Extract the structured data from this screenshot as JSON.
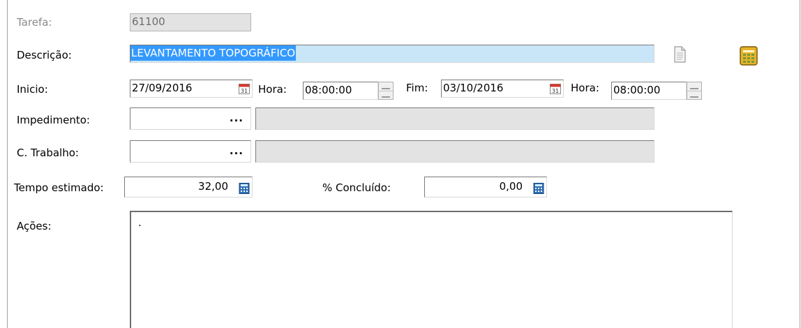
{
  "tarefa": {
    "label": "Tarefa:",
    "value": "61100"
  },
  "descricao": {
    "label": "Descrição:",
    "value": "LEVANTAMENTO TOPOGRÁFICO"
  },
  "inicio": {
    "label": "Inicio:",
    "date": "27/09/2016",
    "hora_label": "Hora:",
    "hora": "08:00:00"
  },
  "fim": {
    "label": "Fim:",
    "date": "03/10/2016",
    "hora_label": "Hora:",
    "hora": "08:00:00"
  },
  "impedimento": {
    "label": "Impedimento:",
    "code": "",
    "lookup_button": "...",
    "description": ""
  },
  "trabalho": {
    "label": "C. Trabalho:",
    "code": "",
    "lookup_button": "...",
    "description": ""
  },
  "tempo_estimado": {
    "label": "Tempo estimado:",
    "value": "32,00"
  },
  "concluido": {
    "label": "% Concluído:",
    "value": "0,00"
  },
  "acoes": {
    "label": "Ações:",
    "value": "."
  },
  "colors": {
    "selection": "#3399ff",
    "selection_field_bg": "#c8e6f8",
    "readonly_bg": "#e3e3e3"
  },
  "icons": {
    "document": "document-icon",
    "calculator": "calculator-icon",
    "calendar": "calendar-icon",
    "spinner": "spinner-icon"
  }
}
